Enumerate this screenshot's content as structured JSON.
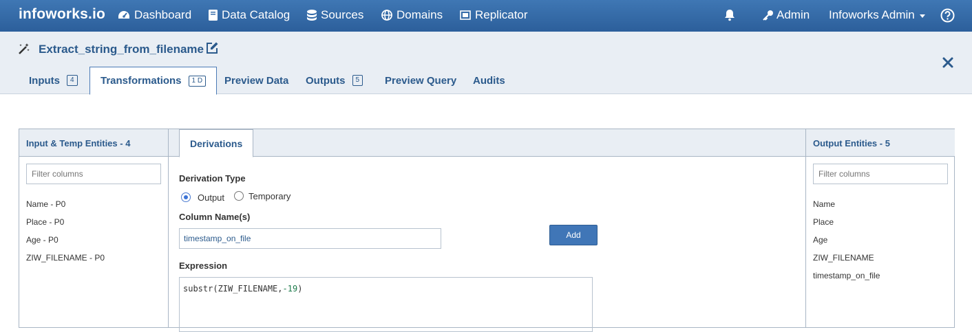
{
  "nav": {
    "brand": "infoworks.io",
    "items": [
      {
        "label": "Dashboard",
        "icon": "dashboard-icon"
      },
      {
        "label": "Data Catalog",
        "icon": "book-icon"
      },
      {
        "label": "Sources",
        "icon": "database-icon"
      },
      {
        "label": "Domains",
        "icon": "globe-icon"
      },
      {
        "label": "Replicator",
        "icon": "replicator-icon"
      }
    ],
    "admin_label": "Admin",
    "user_label": "Infoworks Admin"
  },
  "pipeline": {
    "title": "Extract_string_from_filename"
  },
  "tabs": [
    {
      "label": "Inputs",
      "badge": "4"
    },
    {
      "label": "Transformations",
      "badge": "1 D",
      "active": true
    },
    {
      "label": "Preview Data"
    },
    {
      "label": "Outputs",
      "badge": "5"
    },
    {
      "label": "Preview Query"
    },
    {
      "label": "Audits"
    }
  ],
  "left_panel": {
    "title": "Input & Temp Entities - 4",
    "filter_placeholder": "Filter columns",
    "columns": [
      "Name - P0",
      "Place - P0",
      "Age - P0",
      "ZIW_FILENAME - P0"
    ]
  },
  "center": {
    "tab_label": "Derivations",
    "derivation_type_label": "Derivation Type",
    "option_output": "Output",
    "option_temporary": "Temporary",
    "selected_option": "Output",
    "column_names_label": "Column Name(s)",
    "column_name_value": "timestamp_on_file",
    "add_label": "Add",
    "expression_label": "Expression",
    "expression_prefix": "substr(ZIW_FILENAME,",
    "expression_number": "-19",
    "expression_suffix": ")"
  },
  "right_panel": {
    "title": "Output Entities  - 5",
    "filter_placeholder": "Filter columns",
    "columns": [
      "Name",
      "Place",
      "Age",
      "ZIW_FILENAME",
      "timestamp_on_file"
    ]
  },
  "colors": {
    "nav_bg": "#3a6fab",
    "accent": "#2b5a8c",
    "header_bg": "#e9eef4",
    "button_bg": "#4076b7"
  }
}
